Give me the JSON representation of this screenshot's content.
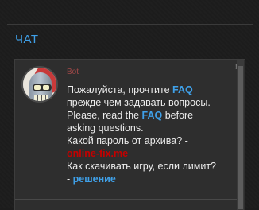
{
  "header": {
    "title": "ЧАТ"
  },
  "message": {
    "author": "Bot",
    "flags": "!!!",
    "line1_prefix": "Пожалуйста, прочтите ",
    "faq1": "FAQ",
    "line2": "прежде чем задавать вопросы.",
    "line3_prefix": "Please, read the ",
    "faq2": "FAQ",
    "line3_suffix": " before",
    "line4": "asking questions.",
    "line5": "Какой пароль от архива? -",
    "link_password": "online-fix.me",
    "line7": "Как скачивать игру, если лимит?",
    "line8_prefix": "- ",
    "link_solution": "решение"
  },
  "colors": {
    "accent": "#3fa0e8",
    "author": "#a04848",
    "warning_link": "#c40000",
    "text": "#ececec",
    "panel": "#2e2e2e",
    "page": "#1c1c1c"
  }
}
